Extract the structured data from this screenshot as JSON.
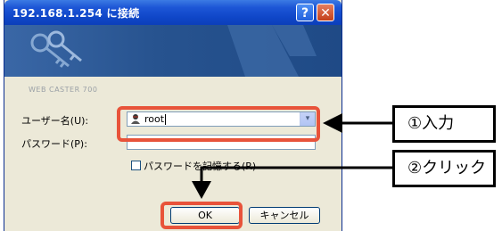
{
  "dialog": {
    "title": "192.168.1.254 に接続",
    "help_button": "?",
    "close_button": "✕",
    "site_text": "WEB CASTER 700",
    "username_label": "ユーザー名(U):",
    "username_value": "root",
    "password_label": "パスワード(P):",
    "password_value": "",
    "remember_label": "パスワードを記憶する(R)",
    "remember_checked": false,
    "ok_label": "OK",
    "cancel_label": "キャンセル",
    "dropdown_icon": "chevron-down-icon"
  },
  "callouts": {
    "step1": "①入力",
    "step2": "②クリック"
  },
  "colors": {
    "highlight": "#e8533a",
    "title_bar": "#0f46c8"
  }
}
